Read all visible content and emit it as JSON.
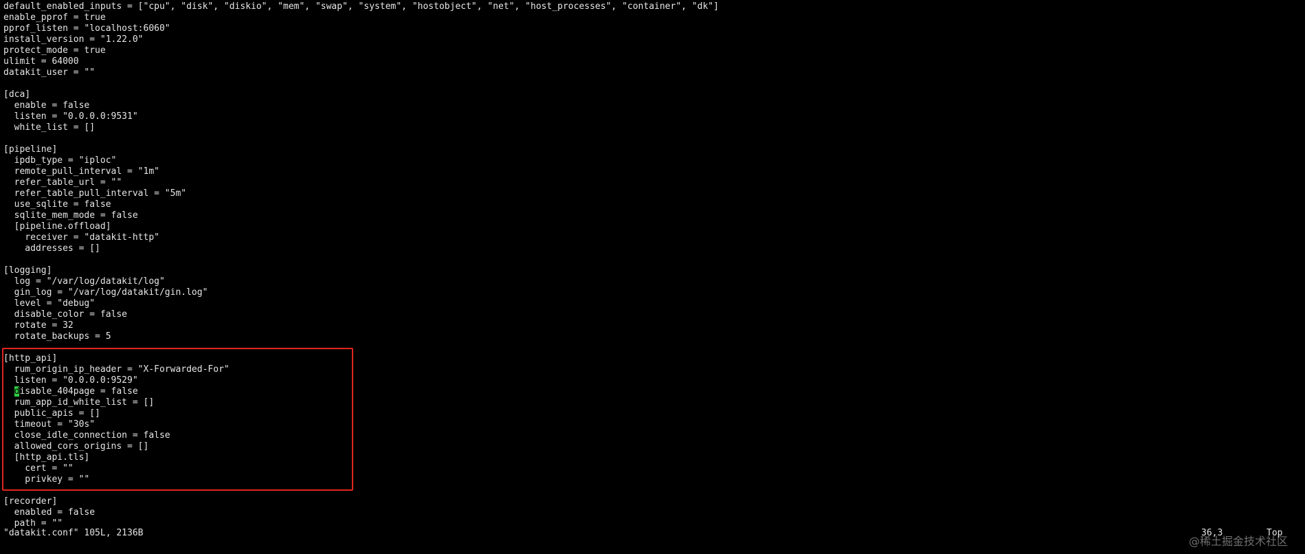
{
  "editor": {
    "lines": [
      "default_enabled_inputs = [\"cpu\", \"disk\", \"diskio\", \"mem\", \"swap\", \"system\", \"hostobject\", \"net\", \"host_processes\", \"container\", \"dk\"]",
      "enable_pprof = true",
      "pprof_listen = \"localhost:6060\"",
      "install_version = \"1.22.0\"",
      "protect_mode = true",
      "ulimit = 64000",
      "datakit_user = \"\"",
      "",
      "[dca]",
      "  enable = false",
      "  listen = \"0.0.0.0:9531\"",
      "  white_list = []",
      "",
      "[pipeline]",
      "  ipdb_type = \"iploc\"",
      "  remote_pull_interval = \"1m\"",
      "  refer_table_url = \"\"",
      "  refer_table_pull_interval = \"5m\"",
      "  use_sqlite = false",
      "  sqlite_mem_mode = false",
      "  [pipeline.offload]",
      "    receiver = \"datakit-http\"",
      "    addresses = []",
      "",
      "[logging]",
      "  log = \"/var/log/datakit/log\"",
      "  gin_log = \"/var/log/datakit/gin.log\"",
      "  level = \"debug\"",
      "  disable_color = false",
      "  rotate = 32",
      "  rotate_backups = 5",
      "",
      "[http_api]",
      "  rum_origin_ip_header = \"X-Forwarded-For\"",
      "  listen = \"0.0.0.0:9529\"",
      "  disable_404page = false",
      "  rum_app_id_white_list = []",
      "  public_apis = []",
      "  timeout = \"30s\"",
      "  close_idle_connection = false",
      "  allowed_cors_origins = []",
      "  [http_api.tls]",
      "    cert = \"\"",
      "    privkey = \"\"",
      "",
      "[recorder]",
      "  enabled = false",
      "  path = \"\""
    ],
    "cursor": {
      "line": 36,
      "column": 3
    }
  },
  "status_bar": {
    "file_info": "\"datakit.conf\" 105L, 2136B",
    "position": "36,3",
    "scroll": "Top"
  },
  "watermark": "@稀土掘金技术社区",
  "colors": {
    "background": "#000000",
    "text": "#e6e6e6",
    "cursor": "#2ecc40",
    "highlight_border": "#e0271f"
  }
}
